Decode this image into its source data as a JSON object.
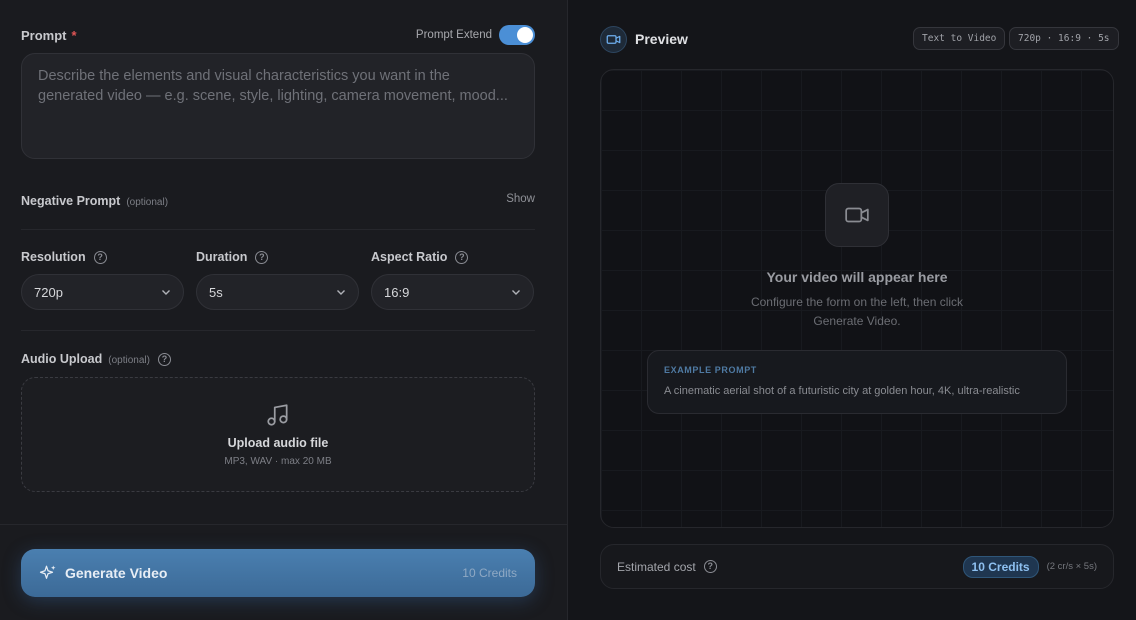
{
  "form": {
    "prompt_label": "Prompt",
    "required_mark": "*",
    "prompt_extend_label": "Prompt Extend",
    "prompt_extend_on": true,
    "prompt_placeholder": "Describe the elements and visual characteristics you want in the generated video — e.g. scene, style, lighting, camera movement, mood...",
    "negative_label": "Negative Prompt",
    "negative_optional": "(optional)",
    "show_label": "Show",
    "resolution_label": "Resolution",
    "resolution_value": "720p",
    "duration_label": "Duration",
    "duration_value": "5s",
    "aspect_label": "Aspect Ratio",
    "aspect_value": "16:9",
    "audio_label": "Audio Upload",
    "audio_optional": "(optional)",
    "upload_title": "Upload audio file",
    "upload_sub": "MP3, WAV · max 20 MB",
    "generate_label": "Generate Video",
    "generate_credits": "10 Credits",
    "help_glyph": "?"
  },
  "preview": {
    "title": "Preview",
    "mode_pill": "Text to Video",
    "spec_pill": "720p · 16:9 · 5s",
    "empty_title": "Your video will appear here",
    "empty_sub": "Configure the form on the left, then click Generate Video.",
    "example_label": "EXAMPLE PROMPT",
    "example_text": "A cinematic aerial shot of a futuristic city at golden hour, 4K, ultra-realistic"
  },
  "cost": {
    "label": "Estimated cost",
    "credits": "10 Credits",
    "note": "(2 cr/s × 5s)"
  },
  "colors": {
    "accent": "#4b8fd6",
    "button": "#3c6a97",
    "required": "#e05555"
  }
}
